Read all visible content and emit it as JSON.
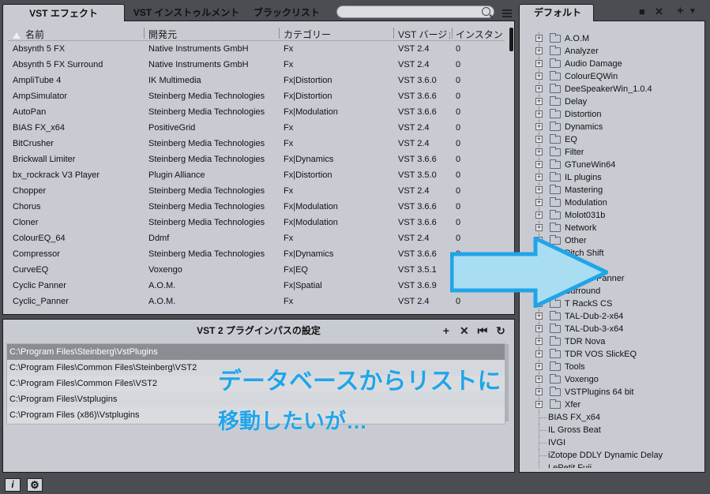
{
  "tabs": {
    "vst_effects": "VST エフェクト",
    "vst_instruments": "VST インストゥルメント",
    "blacklist": "ブラックリスト"
  },
  "table": {
    "headers": [
      "名前",
      "開発元",
      "カテゴリー",
      "VST バージョン",
      "インスタンス"
    ],
    "rows": [
      [
        "Absynth 5 FX",
        "Native Instruments GmbH",
        "Fx",
        "VST 2.4",
        "0"
      ],
      [
        "Absynth 5 FX Surround",
        "Native Instruments GmbH",
        "Fx",
        "VST 2.4",
        "0"
      ],
      [
        "AmpliTube 4",
        "IK Multimedia",
        "Fx|Distortion",
        "VST 3.6.0",
        "0"
      ],
      [
        "AmpSimulator",
        "Steinberg Media Technologies",
        "Fx|Distortion",
        "VST 3.6.6",
        "0"
      ],
      [
        "AutoPan",
        "Steinberg Media Technologies",
        "Fx|Modulation",
        "VST 3.6.6",
        "0"
      ],
      [
        "BIAS FX_x64",
        "PositiveGrid",
        "Fx",
        "VST 2.4",
        "0"
      ],
      [
        "BitCrusher",
        "Steinberg Media Technologies",
        "Fx",
        "VST 2.4",
        "0"
      ],
      [
        "Brickwall Limiter",
        "Steinberg Media Technologies",
        "Fx|Dynamics",
        "VST 3.6.6",
        "0"
      ],
      [
        "bx_rockrack V3 Player",
        "Plugin Alliance",
        "Fx|Distortion",
        "VST 3.5.0",
        "0"
      ],
      [
        "Chopper",
        "Steinberg Media Technologies",
        "Fx",
        "VST 2.4",
        "0"
      ],
      [
        "Chorus",
        "Steinberg Media Technologies",
        "Fx|Modulation",
        "VST 3.6.6",
        "0"
      ],
      [
        "Cloner",
        "Steinberg Media Technologies",
        "Fx|Modulation",
        "VST 3.6.6",
        "0"
      ],
      [
        "ColourEQ_64",
        "Ddmf",
        "Fx",
        "VST 2.4",
        "0"
      ],
      [
        "Compressor",
        "Steinberg Media Technologies",
        "Fx|Dynamics",
        "VST 3.6.6",
        "0"
      ],
      [
        "CurveEQ",
        "Voxengo",
        "Fx|EQ",
        "VST 3.5.1",
        "0"
      ],
      [
        "Cyclic Panner",
        "A.O.M.",
        "Fx|Spatial",
        "VST 3.6.9",
        "0"
      ],
      [
        "Cyclic_Panner",
        "A.O.M.",
        "Fx",
        "VST 2.4",
        "0"
      ]
    ]
  },
  "path_panel": {
    "title": "VST 2 プラグインパスの設定",
    "tools": [
      "+",
      "✕",
      "⏮",
      "↻"
    ],
    "paths": [
      "C:\\Program Files\\Steinberg\\VstPlugins",
      "C:\\Program Files\\Common Files\\Steinberg\\VST2",
      "C:\\Program Files\\Common Files\\VST2",
      "C:\\Program Files\\Vstplugins",
      "C:\\Program Files (x86)\\Vstplugins"
    ]
  },
  "right_panel": {
    "tab": "デフォルト",
    "folders": [
      "A.O.M",
      "Analyzer",
      "Audio Damage",
      "ColourEQWin",
      "DeeSpeakerWin_1.0.4",
      "Delay",
      "Distortion",
      "Dynamics",
      "EQ",
      "Filter",
      "GTuneWin64",
      "IL plugins",
      "Mastering",
      "Modulation",
      "Molot031b",
      "Network",
      "Other",
      "Pitch Shift",
      "Reverb",
      "Spatial+Panner",
      "Surround",
      "T RackS CS",
      "TAL-Dub-2-x64",
      "TAL-Dub-3-x64",
      "TDR Nova",
      "TDR VOS SlickEQ",
      "Tools",
      "Voxengo",
      "VSTPlugins 64 bit",
      "Xfer"
    ],
    "leaves": [
      "BIAS FX_x64",
      "IL Gross Beat",
      "IVGI",
      "iZotope DDLY Dynamic Delay",
      "LePetit Fuji"
    ]
  },
  "bottom_bar": {
    "info_label": "i"
  },
  "annotation": {
    "line1": "データベースからリストに",
    "line2": "移動したいが…",
    "color": "#21a4e8"
  }
}
